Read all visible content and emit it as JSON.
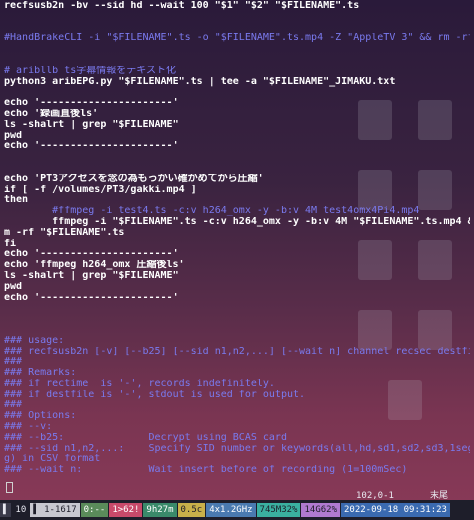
{
  "terminal": {
    "lines": [
      {
        "text": "recfsusb2n -bv --sid hd --wait 100 \"$1\" \"$2\" \"$FILENAME\".ts",
        "style": "bold"
      },
      {
        "text": "",
        "style": ""
      },
      {
        "text": "",
        "style": ""
      },
      {
        "text": "#HandBrakeCLI -i \"$FILENAME\".ts -o \"$FILENAME\".ts.mp4 -Z \"AppleTV 3\" && rm -rf \"$FILENAME\".ts",
        "style": "cm"
      },
      {
        "text": "",
        "style": ""
      },
      {
        "text": "",
        "style": ""
      },
      {
        "text": "# aribllb ts字幕情報をテキスト化",
        "style": "cm"
      },
      {
        "text": "python3 aribEPG.py \"$FILENAME\".ts | tee -a \"$FILENAME\"_JIMAKU.txt",
        "style": "bold"
      },
      {
        "text": "",
        "style": ""
      },
      {
        "text": "echo '----------------------'",
        "style": "bold"
      },
      {
        "text": "echo '録画直後ls'",
        "style": "bold"
      },
      {
        "text": "ls -shalrt | grep \"$FILENAME\"",
        "style": "bold"
      },
      {
        "text": "pwd",
        "style": "bold"
      },
      {
        "text": "echo '----------------------'",
        "style": "bold"
      },
      {
        "text": "",
        "style": ""
      },
      {
        "text": "",
        "style": ""
      },
      {
        "text": "echo 'PT3アクセスを念の為もっかい確かめてから圧縮'",
        "style": "bold"
      },
      {
        "text": "if [ -f /volumes/PT3/gakki.mp4 ]",
        "style": "bold"
      },
      {
        "text": "then",
        "style": "bold"
      },
      {
        "text": "        #ffmpeg -i test4.ts -c:v h264_omx -y -b:v 4M test4omx4Pi4.mp4",
        "style": "cm"
      },
      {
        "text": "        ffmpeg -i \"$FILENAME\".ts -c:v h264_omx -y -b:v 4M \"$FILENAME\".ts.mp4 && r",
        "style": "bold"
      },
      {
        "text": "m -rf \"$FILENAME\".ts",
        "style": "bold"
      },
      {
        "text": "fi",
        "style": "bold"
      },
      {
        "text": "echo '----------------------'",
        "style": "bold"
      },
      {
        "text": "echo 'ffmpeg h264_omx 圧縮後ls'",
        "style": "bold"
      },
      {
        "text": "ls -shalrt | grep \"$FILENAME\"",
        "style": "bold"
      },
      {
        "text": "pwd",
        "style": "bold"
      },
      {
        "text": "echo '----------------------'",
        "style": "bold"
      },
      {
        "text": "",
        "style": ""
      },
      {
        "text": "",
        "style": ""
      },
      {
        "text": "",
        "style": ""
      },
      {
        "text": "### usage:",
        "style": "cm"
      },
      {
        "text": "### recfsusb2n [-v] [--b25] [--sid n1,n2,...] [--wait n] channel recsec destfile",
        "style": "cm"
      },
      {
        "text": "###",
        "style": "cm"
      },
      {
        "text": "### Remarks:",
        "style": "cm"
      },
      {
        "text": "### if rectime  is '-', records indefinitely.",
        "style": "cm"
      },
      {
        "text": "### if destfile is '-', stdout is used for output.",
        "style": "cm"
      },
      {
        "text": "###",
        "style": "cm"
      },
      {
        "text": "### Options:",
        "style": "cm"
      },
      {
        "text": "### --v:",
        "style": "cm"
      },
      {
        "text": "### --b25:              Decrypt using BCAS card",
        "style": "cm"
      },
      {
        "text": "### --sid n1,n2,...:    Specify SID number or keywords(all,hd,sd1,sd2,sd3,1seg,ep",
        "style": "cm"
      },
      {
        "text": "g) in CSV format",
        "style": "cm"
      },
      {
        "text": "### --wait n:           Wait insert before of recording (1=100mSec)",
        "style": "cm"
      }
    ],
    "cursor_position": "102,0-1",
    "scroll_position": "末尾"
  },
  "statusbar": {
    "segments": [
      {
        "text": "▌",
        "bg": "#3a3a4a",
        "fg": "#e8e8f0"
      },
      {
        "text": "10",
        "bg": "#1e1e2a",
        "fg": "#e8e8f0"
      },
      {
        "text": "▌ 1-1617",
        "bg": "#c8c8d0",
        "fg": "#1e1e2a"
      },
      {
        "text": "0:--",
        "bg": "#5a8a5a",
        "fg": "#ffffff"
      },
      {
        "text": "1>62!",
        "bg": "#c84a6a",
        "fg": "#ffffff"
      },
      {
        "text": "9h27m",
        "bg": "#3a8a6a",
        "fg": "#ffffff"
      },
      {
        "text": "0.5c",
        "bg": "#c8b04a",
        "fg": "#1e1e2a"
      },
      {
        "text": "4x1.2GHz",
        "bg": "#4a7ab0",
        "fg": "#ffffff"
      },
      {
        "text": "745M32%",
        "bg": "#3ab0a0",
        "fg": "#1e1e2a"
      },
      {
        "text": "14G62%",
        "bg": "#b07ad0",
        "fg": "#1e1e2a"
      },
      {
        "text": "2022-09-18 09:31:23",
        "bg": "#3a6ab0",
        "fg": "#ffffff"
      }
    ]
  }
}
